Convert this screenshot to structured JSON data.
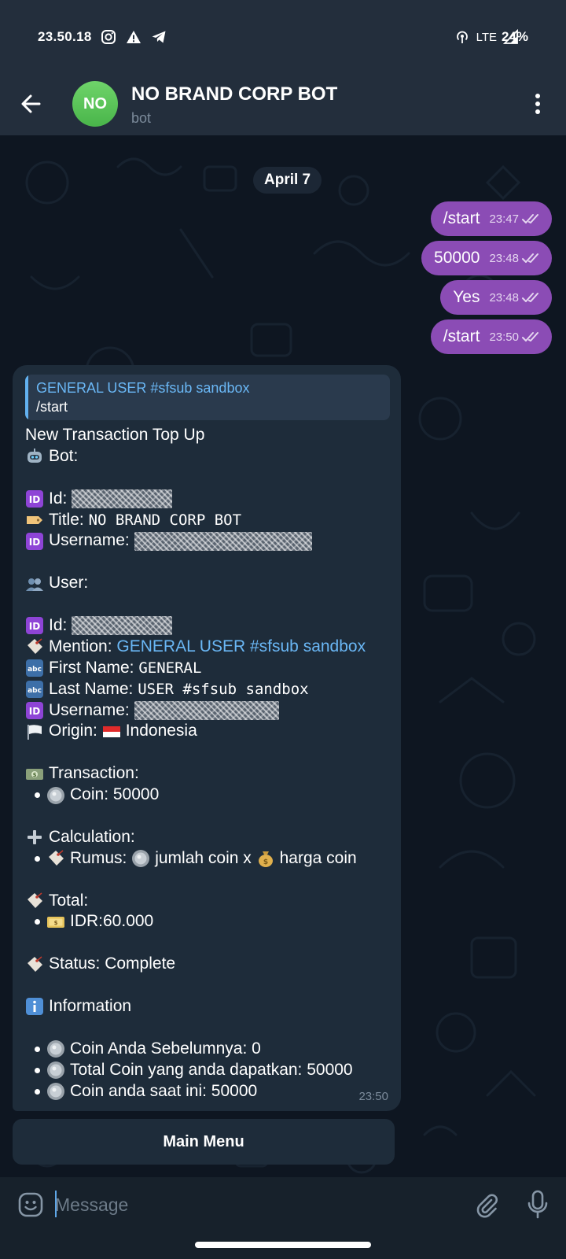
{
  "status_bar": {
    "time": "23.50.18",
    "network": "LTE",
    "battery": "24%",
    "icons_left": [
      "instagram-icon",
      "warning-icon",
      "telegram-icon"
    ],
    "icons_right": [
      "hotspot-icon",
      "signal-icon"
    ]
  },
  "header": {
    "avatar_initials": "NO",
    "title": "NO BRAND CORP BOT",
    "subtitle": "bot",
    "avatar_color": "#4fbc4f"
  },
  "chat": {
    "date_label": "April 7",
    "outgoing": [
      {
        "text": "/start",
        "time": "23:47"
      },
      {
        "text": "50000",
        "time": "23:48"
      },
      {
        "text": "Yes",
        "time": "23:48"
      },
      {
        "text": "/start",
        "time": "23:50"
      }
    ],
    "bot_message": {
      "reply": {
        "name": "GENERAL USER #sfsub sandbox",
        "text": "/start"
      },
      "time": "23:50",
      "heading": "New Transaction Top Up",
      "bot_section": {
        "label": "Bot:",
        "id_label": "Id:",
        "title_label": "Title:",
        "title_value": "NO BRAND CORP BOT",
        "username_label": "Username:"
      },
      "user_section": {
        "label": "User:",
        "id_label": "Id:",
        "mention_label": "Mention:",
        "mention_value": "GENERAL USER #sfsub sandbox",
        "first_name_label": "First Name:",
        "first_name_value": "GENERAL",
        "last_name_label": "Last Name:",
        "last_name_value": "USER #sfsub sandbox",
        "username_label": "Username:",
        "origin_label": "Origin:",
        "origin_value": "Indonesia"
      },
      "transaction": {
        "label": "Transaction:",
        "coin_label": "Coin: 50000"
      },
      "calculation": {
        "label": "Calculation:",
        "rumus_label": "Rumus:",
        "rumus_part1": "jumlah coin x",
        "rumus_part2": "harga coin"
      },
      "total": {
        "label": "Total:",
        "value": "IDR:60.000"
      },
      "status": "Status: Complete",
      "information": {
        "label": "Information",
        "items": [
          "Coin Anda Sebelumnya: 0",
          "Total Coin yang anda dapatkan: 50000",
          "Coin anda saat ini: 50000"
        ]
      }
    },
    "keyboard_button": "Main Menu"
  },
  "input": {
    "placeholder": "Message"
  },
  "colors": {
    "outgoing_bubble": "#8b4cb5",
    "incoming_bubble": "#1e2c3a",
    "link": "#6ab7f5",
    "chat_background": "#0e1621"
  }
}
